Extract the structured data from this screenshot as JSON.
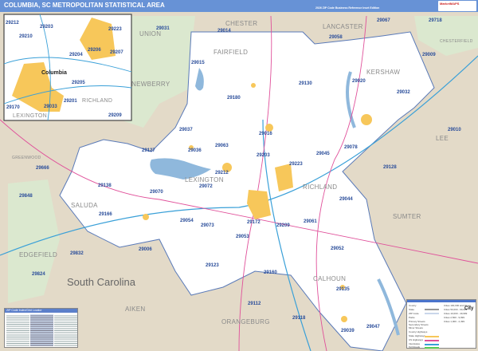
{
  "header": {
    "title": "COLUMBIA, SC METROPOLITAN STATISTICAL AREA",
    "edition": "2026 ZIP Code Business Reference Inset Edition",
    "logo": "MarketMAPS"
  },
  "colors": {
    "header": "#6792d6",
    "land": "#e3dac8",
    "msa": "#ffffff",
    "parks": "#d8e8c8",
    "water": "#8fb8dc",
    "urban": "#f7c75a",
    "zip_text": "#2a4d9a",
    "interstate": "#3aa0d8",
    "us_highway": "#e0509a"
  },
  "counties": [
    "UNION",
    "CHESTER",
    "LANCASTER",
    "CHESTERFIELD",
    "FAIRFIELD",
    "KERSHAW",
    "NEWBERRY",
    "GREENWOOD",
    "SALUDA",
    "LEXINGTON",
    "RICHLAND",
    "LEE",
    "SUMTER",
    "EDGEFIELD",
    "AIKEN",
    "CALHOUN",
    "ORANGEBURG"
  ],
  "state_label": "South Carolina",
  "zips": [
    "29031",
    "29014",
    "29058",
    "29067",
    "29718",
    "29009",
    "29015",
    "29180",
    "29130",
    "29020",
    "29032",
    "29010",
    "29016",
    "29036",
    "29063",
    "29203",
    "29045",
    "29078",
    "29127",
    "29666",
    "29138",
    "29070",
    "29072",
    "29223",
    "29128",
    "29848",
    "29166",
    "29054",
    "29073",
    "29172",
    "29209",
    "29061",
    "29044",
    "29053",
    "29006",
    "29832",
    "29824",
    "29052",
    "29123",
    "29160",
    "29135",
    "29112",
    "29118",
    "29039",
    "29047",
    "29212",
    "29037"
  ],
  "inset": {
    "city": "Columbia",
    "counties": [
      "RICHLAND",
      "LEXINGTON"
    ],
    "zips": [
      "29212",
      "29203",
      "29210",
      "29223",
      "29204",
      "29206",
      "29207",
      "29201",
      "29205",
      "29033",
      "29170",
      "29209"
    ]
  },
  "index": {
    "title": "ZIP Code Index/Grid Locator"
  },
  "legend": {
    "items": [
      "County",
      "State",
      "ZIP Code",
      "Parks",
      "Primary Streets",
      "Secondary Streets",
      "Minor Streets",
      "County Highways",
      "State Highways",
      "US Highways",
      "Interstates",
      "Toll Roads"
    ],
    "cities": [
      "Cities 100,000 and Above",
      "Cities 50,000 - 99,999",
      "Cities 10,000 - 49,999",
      "Cities 2,500 - 9,999",
      "Cities 1,000 - 2,499"
    ],
    "city_sample": "City"
  }
}
